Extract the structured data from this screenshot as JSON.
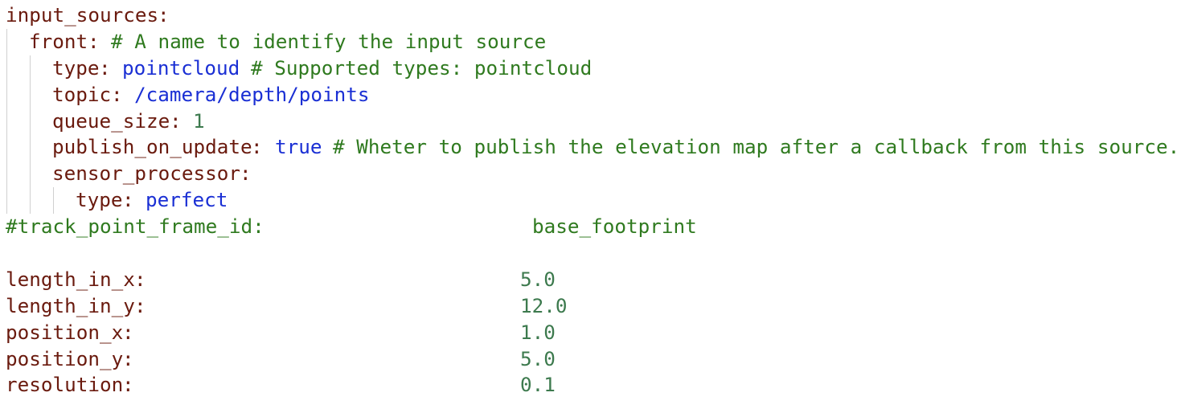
{
  "editor": {
    "lines": [
      {
        "key": "input_sources",
        "sep": ":"
      },
      {
        "key": "front",
        "sep": ":",
        "comment": "# A name to identify the input source"
      },
      {
        "key": "type",
        "sep": ":",
        "value": "pointcloud",
        "comment": "# Supported types: pointcloud"
      },
      {
        "key": "topic",
        "sep": ":",
        "value": "/camera/depth/points"
      },
      {
        "key": "queue_size",
        "sep": ":",
        "value": "1"
      },
      {
        "key": "publish_on_update",
        "sep": ":",
        "value": "true",
        "comment": "# Wheter to publish the elevation map after a callback from this source."
      },
      {
        "key": "sensor_processor",
        "sep": ":"
      },
      {
        "key": "type",
        "sep": ":",
        "value": "perfect"
      },
      {
        "comment": "#track_point_frame_id:",
        "value": "base_footprint"
      },
      {},
      {
        "key": "length_in_x",
        "sep": ":",
        "value": "5.0"
      },
      {
        "key": "length_in_y",
        "sep": ":",
        "value": "12.0"
      },
      {
        "key": "position_x",
        "sep": ":",
        "value": "1.0"
      },
      {
        "key": "position_y",
        "sep": ":",
        "value": "5.0"
      },
      {
        "key": "resolution",
        "sep": ":",
        "value": "0.1"
      }
    ]
  }
}
